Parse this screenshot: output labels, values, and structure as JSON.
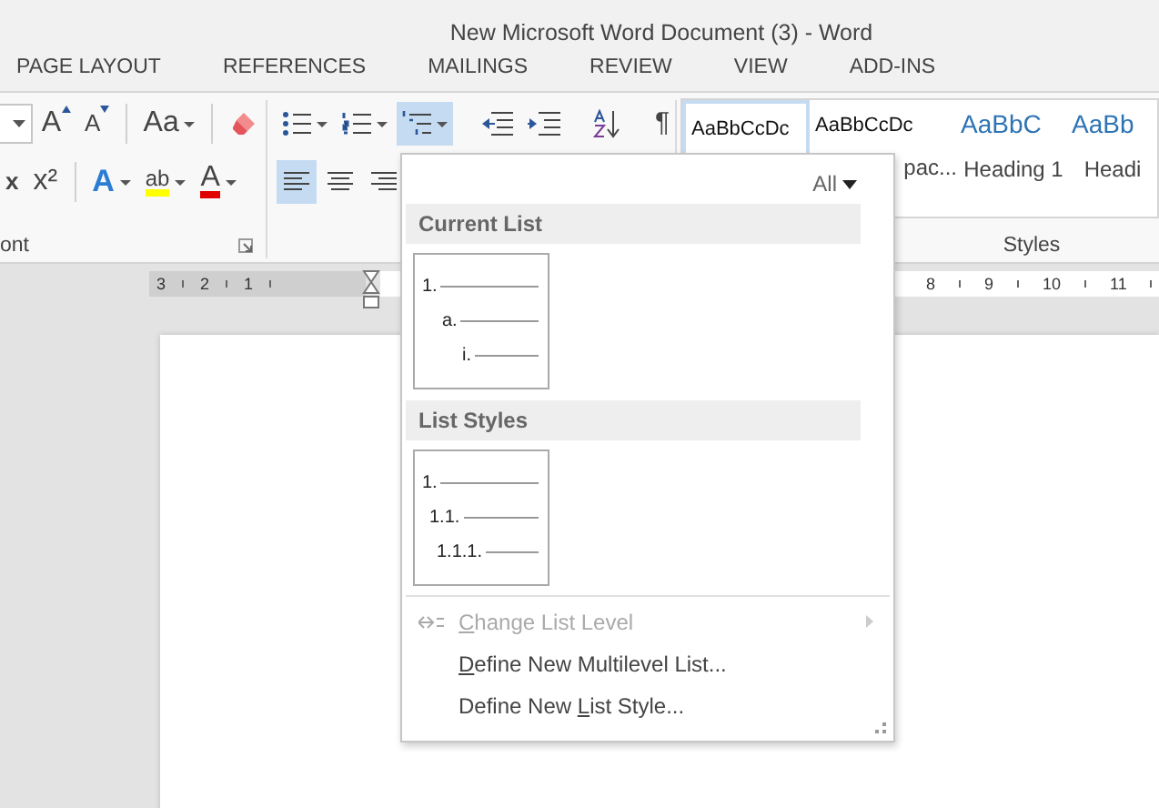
{
  "window": {
    "title": "New Microsoft Word Document (3) - Word"
  },
  "tabs": [
    {
      "label": "PAGE LAYOUT",
      "selected": false
    },
    {
      "label": "REFERENCES",
      "selected": false
    },
    {
      "label": "MAILINGS",
      "selected": false
    },
    {
      "label": "REVIEW",
      "selected": false
    },
    {
      "label": "VIEW",
      "selected": false
    },
    {
      "label": "ADD-INS",
      "selected": false
    }
  ],
  "font_group": {
    "label": "ont",
    "row1": [
      {
        "kind": "combo"
      },
      {
        "kind": "grow",
        "glyph": "A"
      },
      {
        "kind": "shrink",
        "glyph": "A"
      },
      {
        "kind": "divider"
      },
      {
        "kind": "glyph",
        "glyph": "Aa",
        "dropdown": true
      },
      {
        "kind": "divider"
      },
      {
        "kind": "eraser"
      }
    ],
    "row2": [
      {
        "kind": "glyph",
        "glyph": "x"
      },
      {
        "kind": "glyph",
        "glyph": "x²"
      },
      {
        "kind": "divider"
      },
      {
        "kind": "effects",
        "glyph": "A",
        "dropdown": true
      },
      {
        "kind": "highlight",
        "glyph": "ab",
        "color": "#ffff00",
        "dropdown": true
      },
      {
        "kind": "fontcolor",
        "glyph": "A",
        "color": "#e00000",
        "dropdown": true
      }
    ]
  },
  "paragraph_group": {
    "row1": [
      {
        "kind": "bullets",
        "dropdown": true,
        "selected": false
      },
      {
        "kind": "numbering",
        "dropdown": true,
        "selected": false
      },
      {
        "kind": "multilevel",
        "dropdown": true,
        "selected": true
      },
      {
        "kind": "divider"
      },
      {
        "kind": "outdent",
        "selected": false
      },
      {
        "kind": "indent",
        "selected": false
      },
      {
        "kind": "divider"
      },
      {
        "kind": "sort",
        "selected": false
      },
      {
        "kind": "divider"
      },
      {
        "kind": "glyph",
        "glyph": "¶",
        "selected": false
      }
    ],
    "row2": [
      {
        "kind": "align-left",
        "selected": true
      },
      {
        "kind": "align-center",
        "selected": false
      },
      {
        "kind": "align-right",
        "selected": false
      }
    ]
  },
  "styles_group": {
    "label": "Styles",
    "items": [
      {
        "preview": "AaBbCcDc",
        "kind": "normal",
        "selected": true
      },
      {
        "preview": "AaBbCcDc",
        "name": "pac...",
        "kind": "normal",
        "selected": false
      },
      {
        "preview": "AaBbC",
        "name": "Heading 1",
        "kind": "heading",
        "selected": false
      },
      {
        "preview": "AaBb",
        "name": "Headi",
        "kind": "heading",
        "selected": false
      }
    ]
  },
  "ruler": {
    "left_numbers": [
      "3",
      "2",
      "1"
    ],
    "right_numbers": [
      "8",
      "9",
      "10",
      "11"
    ]
  },
  "multilevel_menu": {
    "filter": "All",
    "sections": [
      {
        "title": "Current List",
        "thumbnails": [
          {
            "levels": [
              {
                "label": "1.",
                "children": [
                  {
                    "label": "a.",
                    "children": [
                      {
                        "label": "i."
                      }
                    ]
                  }
                ]
              }
            ]
          }
        ]
      },
      {
        "title": "List Styles",
        "thumbnails": [
          {
            "levels": [
              {
                "label": "1.",
                "children": [
                  {
                    "label": "1.1.",
                    "children": [
                      {
                        "label": "1.1.1."
                      }
                    ]
                  }
                ]
              }
            ]
          }
        ]
      }
    ],
    "commands": [
      {
        "key": "C",
        "after": "hange List Level",
        "disabled": true,
        "submenu": true,
        "kind": "level"
      },
      {
        "key": "D",
        "after": "efine New Multilevel List...",
        "disabled": false,
        "submenu": false
      },
      {
        "before": "Define New ",
        "key": "L",
        "after": "ist Style...",
        "disabled": false,
        "submenu": false
      }
    ]
  }
}
